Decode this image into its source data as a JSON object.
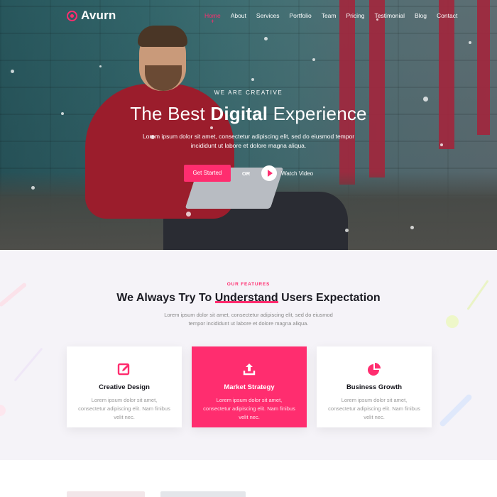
{
  "brand": {
    "name": "Avurn"
  },
  "nav": {
    "items": [
      {
        "label": "Home",
        "active": true
      },
      {
        "label": "About"
      },
      {
        "label": "Services"
      },
      {
        "label": "Portfolio"
      },
      {
        "label": "Team"
      },
      {
        "label": "Pricing"
      },
      {
        "label": "Testimonial"
      },
      {
        "label": "Blog"
      },
      {
        "label": "Contact"
      }
    ]
  },
  "hero": {
    "eyebrow": "WE ARE CREATIVE",
    "title_before": "The Best ",
    "title_highlight": "Digital",
    "title_after": " Experience",
    "description": "Lorem ipsum dolor sit amet, consectetur adipiscing elit, sed do eiusmod tempor incididunt ut labore et dolore magna aliqua.",
    "cta_label": "Get Started",
    "or_label": "OR",
    "video_label": "Watch Video"
  },
  "features": {
    "eyebrow": "OUR FEATURES",
    "title_before": "We Always Try To ",
    "title_highlight": "Understand",
    "title_after": " Users Expectation",
    "description": "Lorem ipsum dolor sit amet, consectetur adipiscing elit, sed do eiusmod tempor incididunt ut labore et dolore magna aliqua.",
    "cards": [
      {
        "icon": "edit-icon",
        "title": "Creative Design",
        "text": "Lorem ipsum dolor sit amet, consectetur adipiscing elit. Nam finibus velit nec."
      },
      {
        "icon": "upload-icon",
        "title": "Market Strategy",
        "text": "Lorem ipsum dolor sit amet, consectetur adipiscing elit. Nam finibus velit nec."
      },
      {
        "icon": "pie-chart-icon",
        "title": "Business Growth",
        "text": "Lorem ipsum dolor sit amet, consectetur adipiscing elit. Nam finibus velit nec."
      }
    ]
  },
  "colors": {
    "accent": "#ff2d6f",
    "dark": "#1b1b23",
    "muted": "#888888"
  }
}
